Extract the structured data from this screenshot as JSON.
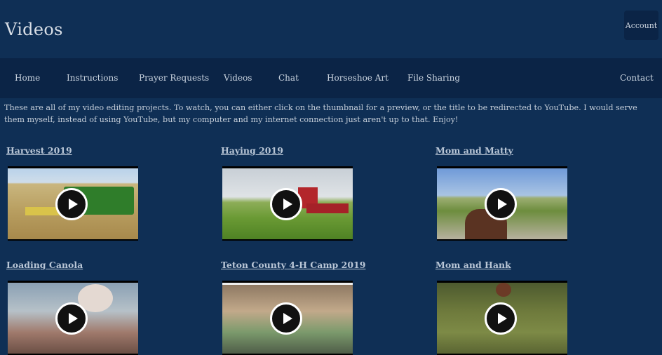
{
  "site": {
    "title": "Videos",
    "account_label": "Account"
  },
  "nav": {
    "items": [
      "Home",
      "Instructions",
      "Prayer Requests",
      "Videos",
      "Chat",
      "Horseshoe Art",
      "File Sharing"
    ],
    "contact": "Contact"
  },
  "intro": "These are all of my video editing projects. To watch, you can either click on the thumbnail for a preview, or the title to be redirected to YouTube. I would serve them myself, instead of using YouTube, but my computer and my internet connection just aren't up to that. Enjoy!",
  "videos": [
    {
      "title": "Harvest 2019"
    },
    {
      "title": "Haying 2019"
    },
    {
      "title": "Mom and Matty"
    },
    {
      "title": "Loading Canola"
    },
    {
      "title": "Teton County 4-H Camp 2019"
    },
    {
      "title": "Mom and Hank"
    }
  ],
  "colors": {
    "background": "#0f2f55",
    "nav": "#0b2446",
    "link": "#b9c6d6"
  }
}
